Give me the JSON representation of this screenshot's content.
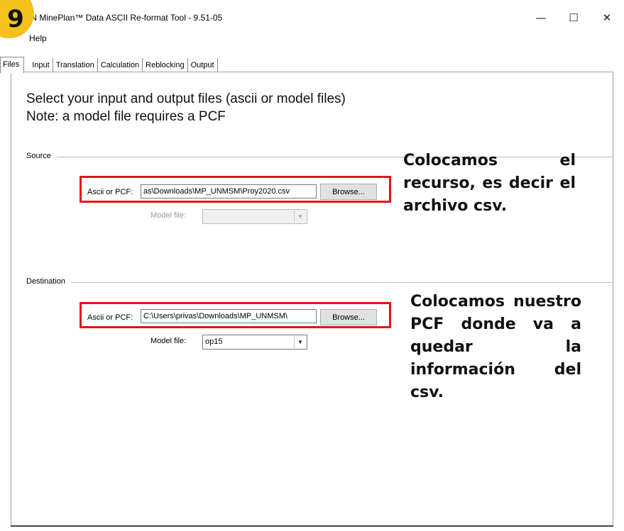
{
  "window": {
    "title": "GN MinePlan™ Data ASCII Re-format Tool - 9.51-05",
    "controls": {
      "minimize": "—",
      "maximize": "☐",
      "close": "✕"
    }
  },
  "badge": {
    "number": "9",
    "color": "#f5c11a"
  },
  "menu": {
    "help": "Help"
  },
  "tabs": [
    {
      "label": "Files",
      "active": true
    },
    {
      "label": "Input"
    },
    {
      "label": "Translation"
    },
    {
      "label": "Calculation"
    },
    {
      "label": "Reblocking"
    },
    {
      "label": "Output"
    }
  ],
  "files_tab": {
    "heading_line1": "Select your input and output files (ascii or model files)",
    "heading_line2": "Note: a model file requires a PCF",
    "source": {
      "group_label": "Source",
      "ascii_label": "Ascii or PCF:",
      "ascii_value": "as\\Downloads\\MP_UNMSM\\Proy2020.csv",
      "browse_label": "Browse...",
      "model_label": "Model file:",
      "model_value": ""
    },
    "destination": {
      "group_label": "Destination",
      "ascii_label": "Ascii or PCF:",
      "ascii_value": "C:\\Users\\privas\\Downloads\\MP_UNMSM\\",
      "browse_label": "Browse...",
      "model_label": "Model file:",
      "model_value": "op15"
    }
  },
  "annotations": {
    "source_note": "Colocamos el recurso, es decir el archivo csv.",
    "destination_note": "Colocamos nuestro PCF donde va a quedar la información del csv."
  },
  "colors": {
    "highlight_box": "#e3141b"
  }
}
